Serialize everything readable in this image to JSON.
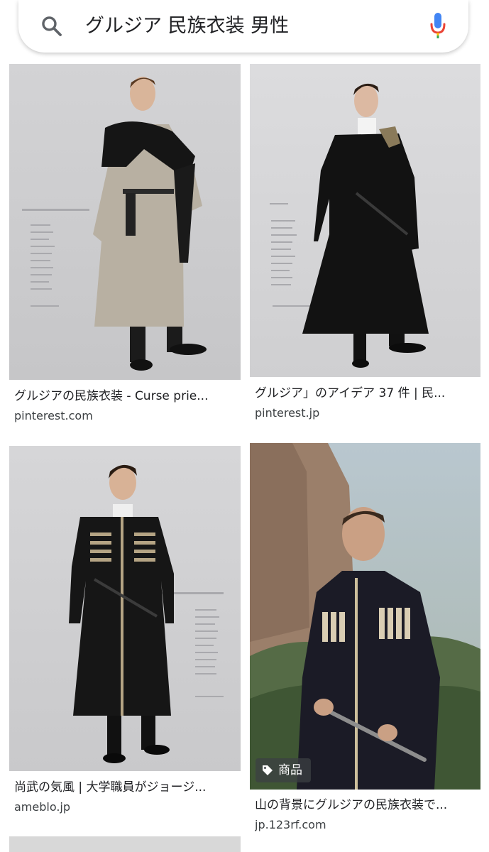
{
  "search": {
    "query": "グルジア 民族衣装 男性",
    "icon": "search-icon",
    "voice_icon": "mic-icon"
  },
  "results": [
    {
      "title": "グルジアの民族衣装 - Curse prie...",
      "source": "pinterest.com"
    },
    {
      "title": "グルジア」のアイデア 37 件 | 民...",
      "source": "pinterest.jp"
    },
    {
      "title": "尚武の気風 | 大学職員がジョージ...",
      "source": "ameblo.jp"
    },
    {
      "title": "山の背景にグルジアの民族衣装で...",
      "source": "jp.123rf.com",
      "badge": "商品"
    }
  ],
  "colors": {
    "accent_blue": "#4285f4",
    "accent_red": "#ea4335",
    "accent_yellow": "#fbbc04",
    "accent_green": "#34a853",
    "text_primary": "#202124",
    "text_secondary": "#3c4043"
  }
}
